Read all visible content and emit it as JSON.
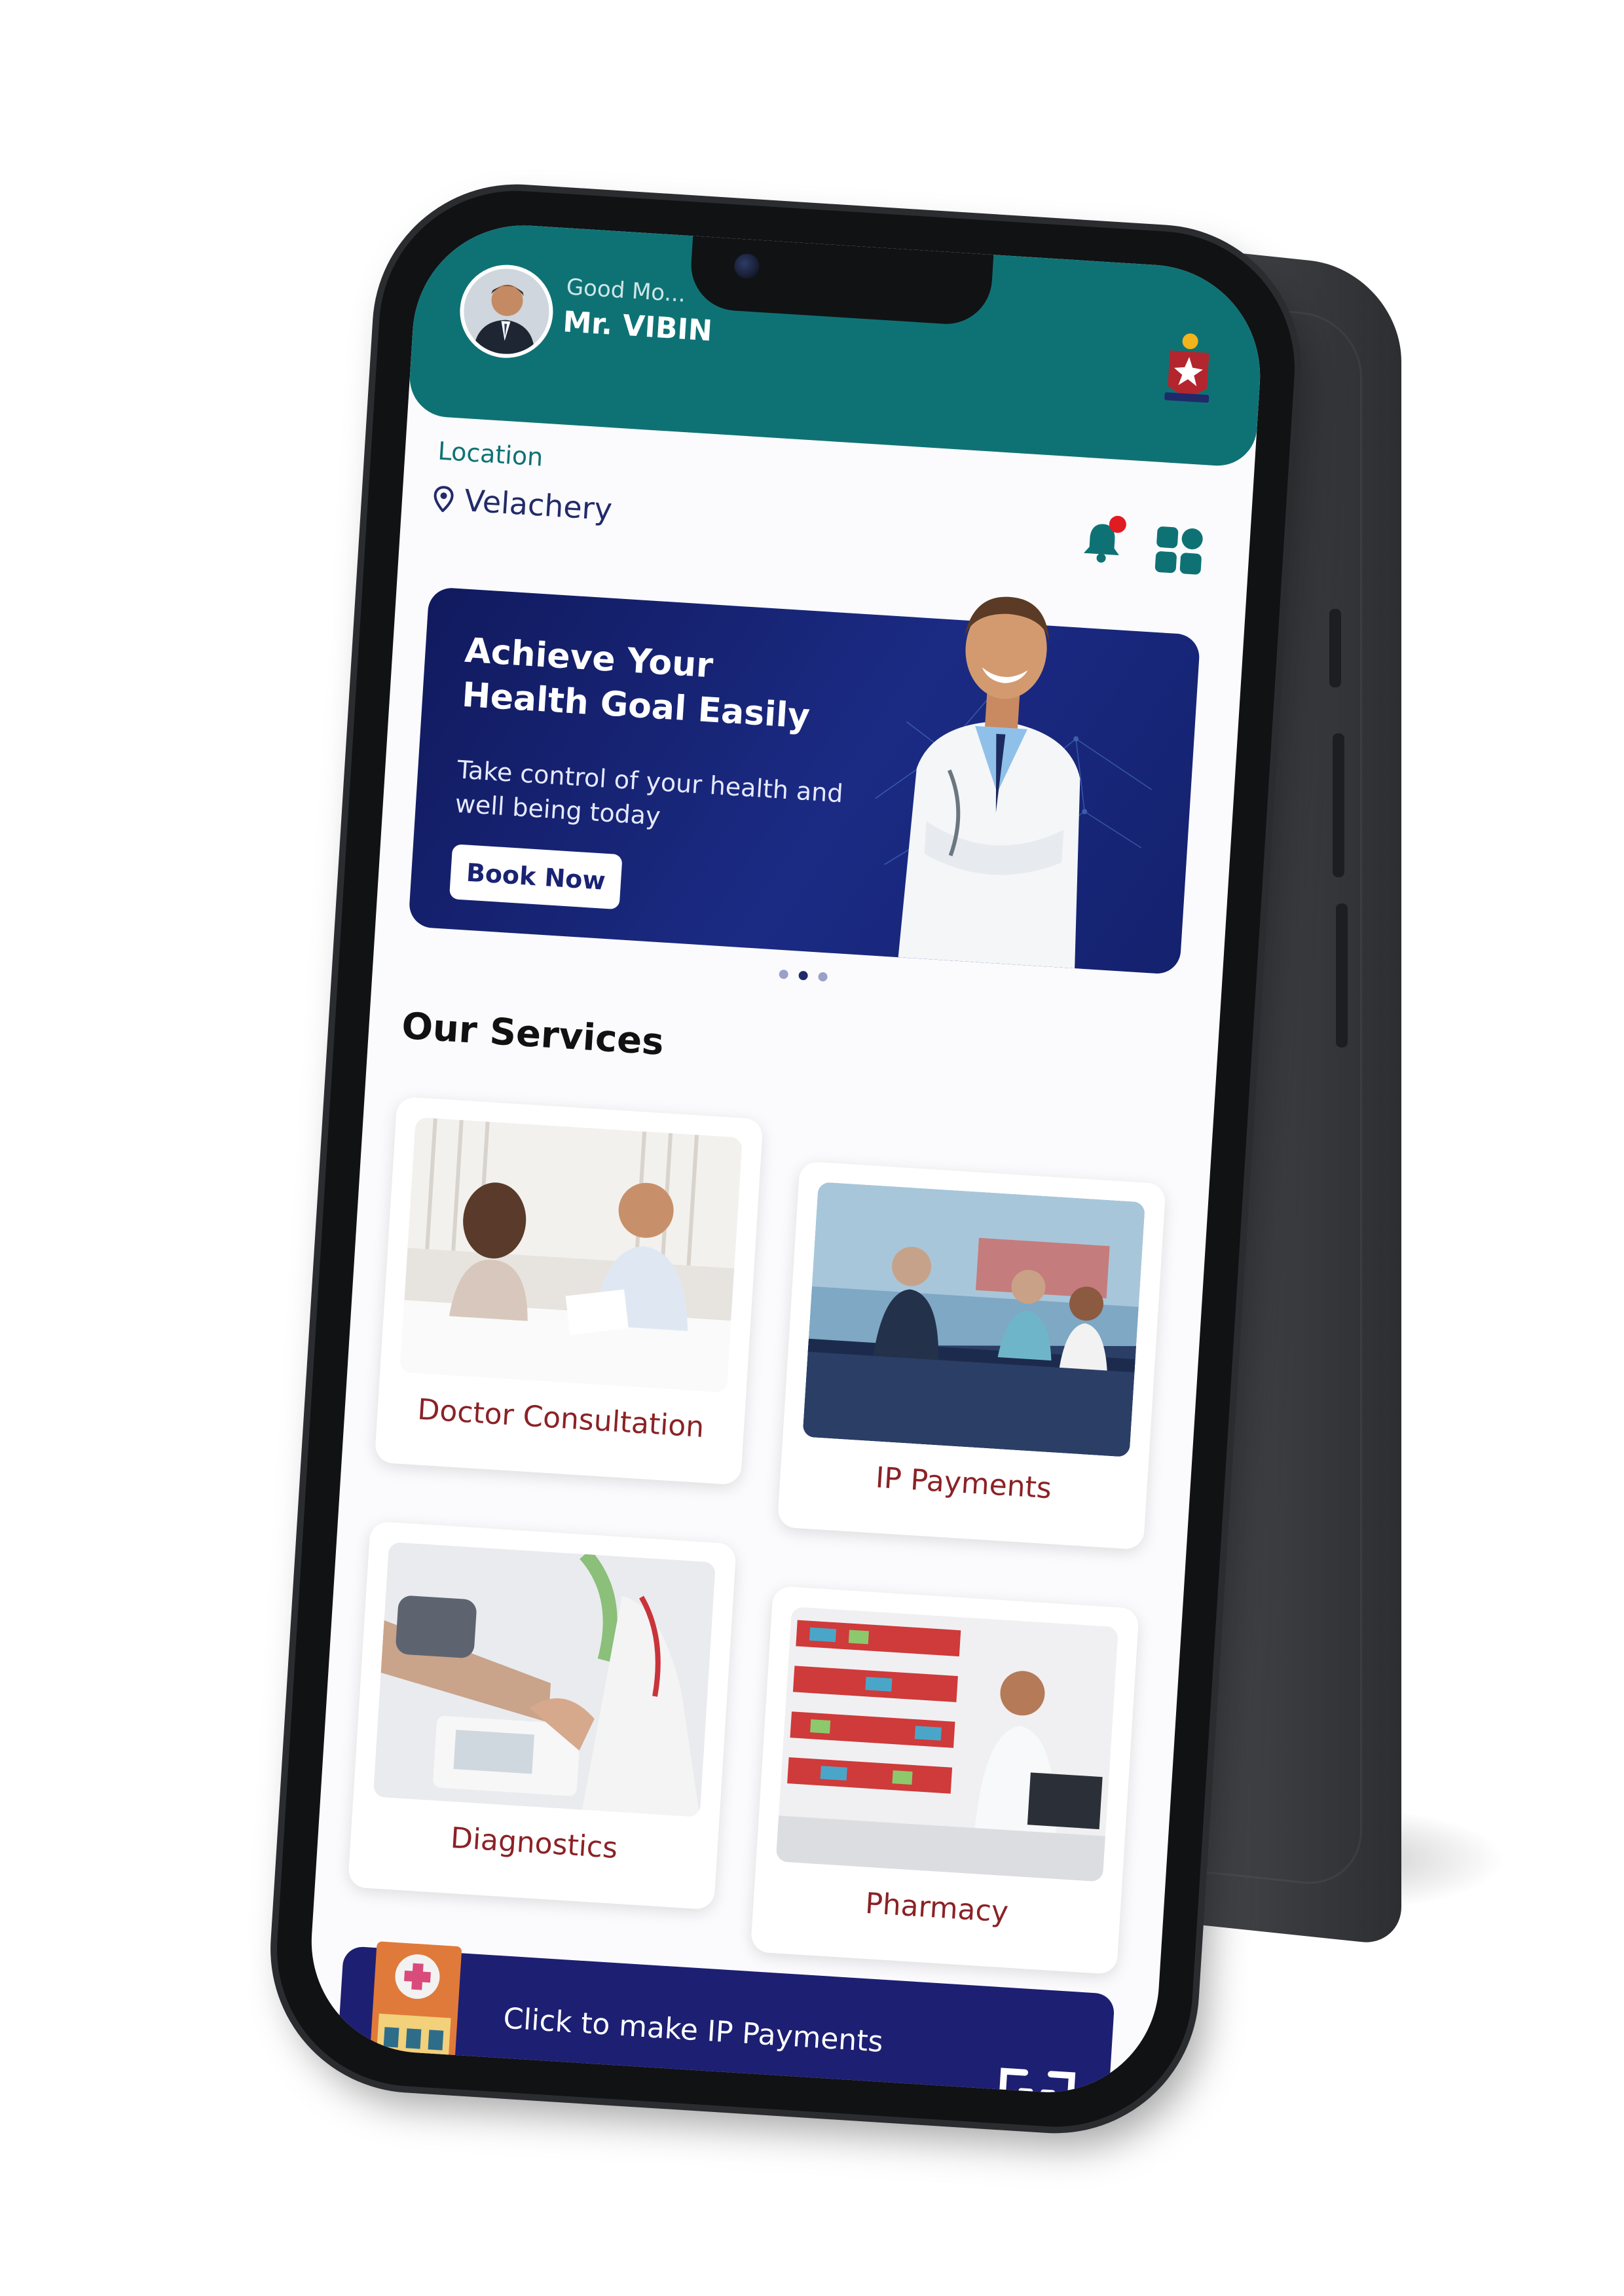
{
  "header": {
    "greeting": "Good Mo...",
    "user_name": "Mr. VIBIN"
  },
  "location": {
    "label": "Location",
    "value": "Velachery"
  },
  "banner": {
    "title": "Achieve Your Health Goal Easily",
    "subtitle": "Take control of your health and well being today",
    "cta_label": "Book Now",
    "slide_count": 3,
    "active_slide": 2
  },
  "services": {
    "title": "Our Services",
    "items": [
      {
        "label": "Doctor Consultation"
      },
      {
        "label": "IP Payments"
      },
      {
        "label": "Diagnostics"
      },
      {
        "label": "Pharmacy"
      }
    ]
  },
  "ip_banner": {
    "text": "Click  to make IP Payments"
  },
  "colors": {
    "header_teal": "#0e7275",
    "navy": "#1d1f73",
    "service_label": "#8b2226",
    "notification_dot": "#e11b22"
  },
  "icons": [
    "location-pin-icon",
    "bell-icon",
    "dashboard-grid-icon",
    "qr-code-icon",
    "hospital-building-icon"
  ]
}
